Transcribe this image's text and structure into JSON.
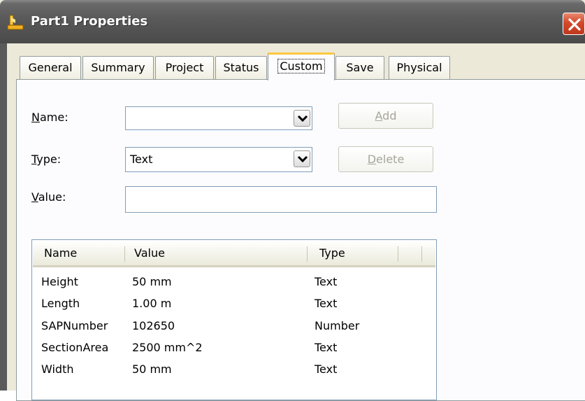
{
  "window": {
    "title": "Part1 Properties"
  },
  "tabs": [
    {
      "label": "General"
    },
    {
      "label": "Summary"
    },
    {
      "label": "Project"
    },
    {
      "label": "Status"
    },
    {
      "label": "Custom",
      "active": true
    },
    {
      "label": "Save"
    },
    {
      "label": "Physical"
    }
  ],
  "form": {
    "name_label": "Name:",
    "name_value": "",
    "type_label": "Type:",
    "type_value": "Text",
    "value_label": "Value:",
    "value_value": "",
    "add_button": "Add",
    "delete_button": "Delete"
  },
  "table": {
    "columns": [
      "Name",
      "Value",
      "Type"
    ],
    "rows": [
      {
        "name": "Height",
        "value": "50 mm",
        "type": "Text"
      },
      {
        "name": "Length",
        "value": "1.00 m",
        "type": "Text"
      },
      {
        "name": "SAPNumber",
        "value": "102650",
        "type": "Number"
      },
      {
        "name": "SectionArea",
        "value": "2500 mm^2",
        "type": "Text"
      },
      {
        "name": "Width",
        "value": "50 mm",
        "type": "Text"
      }
    ]
  },
  "colors": {
    "titlebar": "#5a5a5a",
    "close_button": "#d2492b",
    "active_tab_accent": "#ffc83c",
    "dialog_face": "#ece9d8",
    "disabled_text": "#a7a69b"
  },
  "icons": {
    "app": "inventor-part-icon",
    "close": "close-icon",
    "dropdown": "chevron-down-icon"
  }
}
